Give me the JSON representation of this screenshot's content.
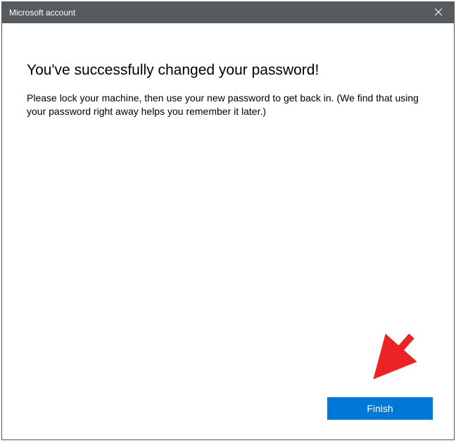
{
  "titlebar": {
    "title": "Microsoft account"
  },
  "content": {
    "heading": "You've successfully changed your password!",
    "body": "Please lock your machine, then use your new password to get back in. (We find that using your password right away helps you remember it later.)"
  },
  "footer": {
    "finish_label": "Finish"
  }
}
